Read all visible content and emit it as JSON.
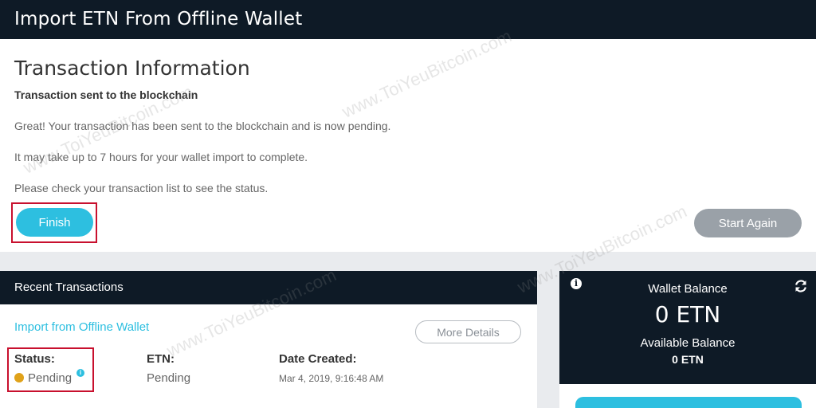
{
  "header": {
    "title": "Import ETN From Offline Wallet"
  },
  "transaction_info": {
    "title": "Transaction Information",
    "subtitle": "Transaction sent to the blockchain",
    "line1": "Great! Your transaction has been sent to the blockchain and is now pending.",
    "line2": "It may take up to 7 hours for your wallet import to complete.",
    "line3": "Please check your transaction list to see the status.",
    "finish_label": "Finish",
    "start_again_label": "Start Again",
    "highlight_color": "#c8102e"
  },
  "recent_transactions": {
    "title": "Recent Transactions",
    "item": {
      "link": "Import from Offline Wallet",
      "more_details_label": "More Details",
      "status_label": "Status:",
      "status_value": "Pending",
      "etn_label": "ETN:",
      "etn_value": "Pending",
      "date_label": "Date Created:",
      "date_value": "Mar 4, 2019, 9:16:48 AM",
      "status_color": "#e0a21a"
    }
  },
  "wallet": {
    "balance_label": "Wallet Balance",
    "balance_value": "0 ETN",
    "available_label": "Available Balance",
    "available_value": "0 ETN",
    "icons": [
      "info-icon",
      "refresh-icon"
    ]
  },
  "watermark": {
    "text": "www.ToiYeuBitcoin.com"
  },
  "theme": {
    "dark": "#0e1a26",
    "accent": "#2dbfe0",
    "muted_button": "#9aa1a8"
  }
}
